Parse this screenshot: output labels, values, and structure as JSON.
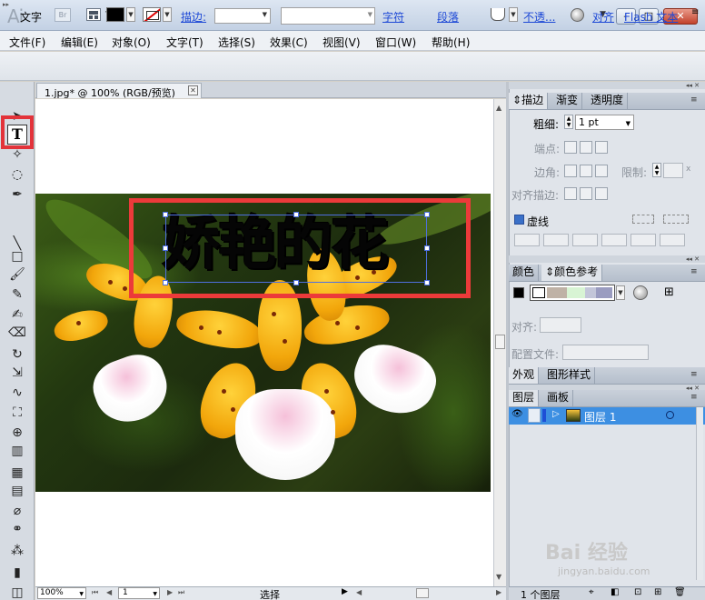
{
  "titlebar": {
    "app_logo": "Ai",
    "bridge_label": "Br"
  },
  "menu": [
    "文件(F)",
    "编辑(E)",
    "对象(O)",
    "文字(T)",
    "选择(S)",
    "效果(C)",
    "视图(V)",
    "窗口(W)",
    "帮助(H)"
  ],
  "control_bar": {
    "tool_label": "文字",
    "stroke_label": "描边:",
    "char_label": "字符",
    "para_label": "段落",
    "opacity_label": "不透...",
    "align_label": "对齐",
    "flash_label": "Flash 文本"
  },
  "document": {
    "tab_label": "1.jpg* @ 100% (RGB/预览)",
    "flower_text": "娇艳的花"
  },
  "status_bar": {
    "zoom": "100%",
    "page": "1",
    "status": "选择"
  },
  "stroke_panel": {
    "tabs": [
      "描边",
      "渐变",
      "透明度"
    ],
    "weight_label": "粗细:",
    "weight_value": "1 pt",
    "cap_label": "端点:",
    "corner_label": "边角:",
    "limit_label": "限制:",
    "limit_suffix": "x",
    "align_label": "对齐描边:",
    "dash_label": "虚线"
  },
  "color_panel": {
    "tabs": [
      "颜色",
      "颜色参考"
    ],
    "align_label": "对齐:",
    "profile_label": "配置文件:"
  },
  "appearance_panel": {
    "tabs": [
      "外观",
      "图形样式"
    ]
  },
  "layers_panel": {
    "tabs": [
      "图层",
      "画板"
    ],
    "layer_name": "图层 1",
    "footer_count": "1 个图层"
  },
  "watermark": {
    "brand": "Bai 经验",
    "url": "jingyan.baidu.com"
  }
}
